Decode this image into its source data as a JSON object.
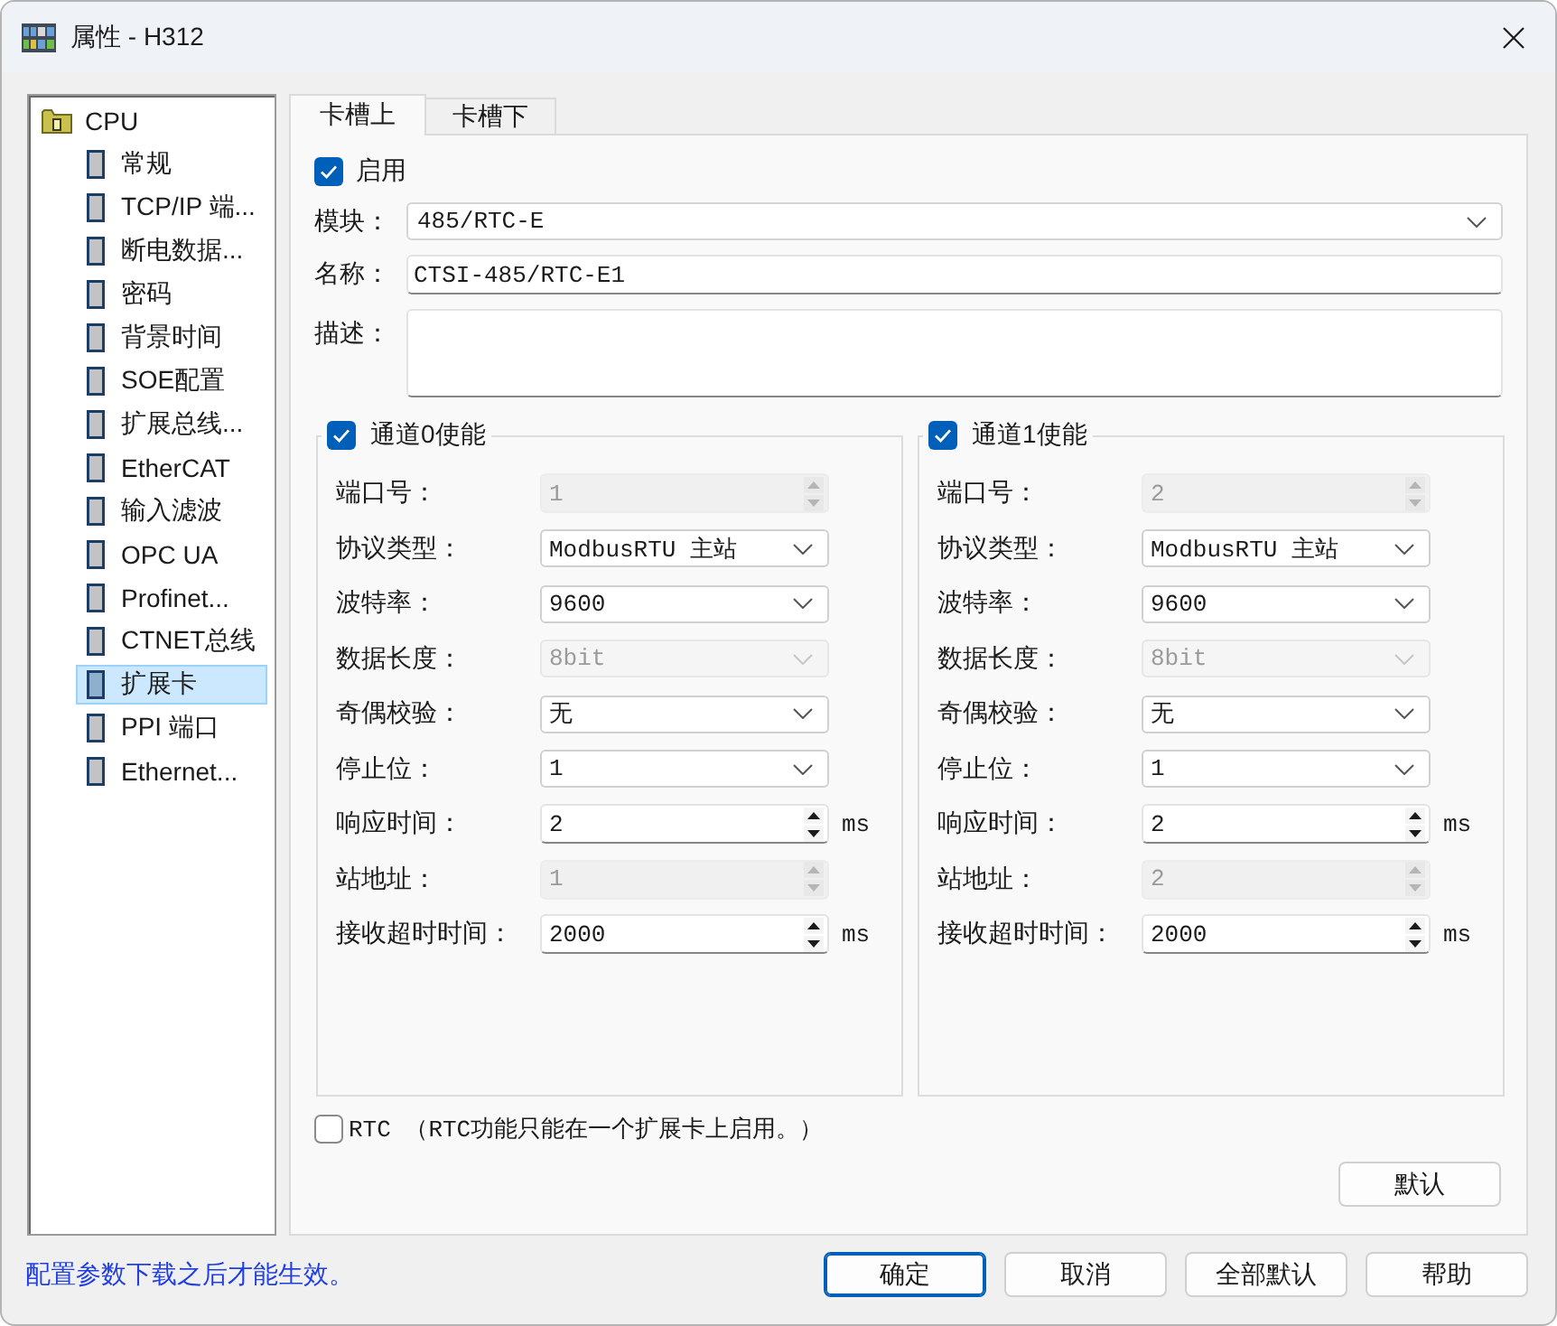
{
  "window": {
    "title": "属性 - H312"
  },
  "tree": [
    {
      "label": "CPU",
      "selected": false,
      "children": [
        {
          "label": "常规",
          "selected": false
        },
        {
          "label": "TCP/IP 端...",
          "selected": false
        },
        {
          "label": "断电数据...",
          "selected": false
        },
        {
          "label": "密码",
          "selected": false
        },
        {
          "label": "背景时间",
          "selected": false
        },
        {
          "label": "SOE配置",
          "selected": false
        },
        {
          "label": "扩展总线...",
          "selected": false
        },
        {
          "label": "EtherCAT",
          "selected": false
        },
        {
          "label": "输入滤波",
          "selected": false
        },
        {
          "label": "OPC UA",
          "selected": false
        },
        {
          "label": "Profinet...",
          "selected": false
        },
        {
          "label": "CTNET总线",
          "selected": false
        },
        {
          "label": "扩展卡",
          "selected": true
        },
        {
          "label": "PPI 端口",
          "selected": false
        },
        {
          "label": "Ethernet...",
          "selected": false
        }
      ]
    }
  ],
  "tabs": [
    {
      "label": "卡槽上",
      "selected": true
    },
    {
      "label": "卡槽下",
      "selected": false
    }
  ],
  "enable": {
    "label": "启用",
    "checked": true
  },
  "module": {
    "label": "模块：",
    "value": "485/RTC-E"
  },
  "name": {
    "label": "名称：",
    "value": "CTSI-485/RTC-E1"
  },
  "description": {
    "label": "描述："
  },
  "channels": [
    {
      "title": "通道0使能",
      "checked": true,
      "fields": [
        {
          "label": "端口号：",
          "kind": "spin",
          "value": "1",
          "disabled": true
        },
        {
          "label": "协议类型：",
          "kind": "select",
          "value": "ModbusRTU 主站",
          "disabled": false
        },
        {
          "label": "波特率：",
          "kind": "select",
          "value": "9600",
          "disabled": false
        },
        {
          "label": "数据长度：",
          "kind": "select",
          "value": "8bit",
          "disabled": true
        },
        {
          "label": "奇偶校验：",
          "kind": "select",
          "value": "无",
          "disabled": false
        },
        {
          "label": "停止位：",
          "kind": "select",
          "value": "1",
          "disabled": false
        },
        {
          "label": "响应时间：",
          "kind": "spin",
          "value": "2",
          "disabled": false,
          "unit": "ms"
        },
        {
          "label": "站地址：",
          "kind": "spin",
          "value": "1",
          "disabled": true
        },
        {
          "label": "接收超时时间：",
          "kind": "spin",
          "value": "2000",
          "disabled": false,
          "unit": "ms"
        }
      ]
    },
    {
      "title": "通道1使能",
      "checked": true,
      "fields": [
        {
          "label": "端口号：",
          "kind": "spin",
          "value": "2",
          "disabled": true
        },
        {
          "label": "协议类型：",
          "kind": "select",
          "value": "ModbusRTU 主站",
          "disabled": false
        },
        {
          "label": "波特率：",
          "kind": "select",
          "value": "9600",
          "disabled": false
        },
        {
          "label": "数据长度：",
          "kind": "select",
          "value": "8bit",
          "disabled": true
        },
        {
          "label": "奇偶校验：",
          "kind": "select",
          "value": "无",
          "disabled": false
        },
        {
          "label": "停止位：",
          "kind": "select",
          "value": "1",
          "disabled": false
        },
        {
          "label": "响应时间：",
          "kind": "spin",
          "value": "2",
          "disabled": false,
          "unit": "ms"
        },
        {
          "label": "站地址：",
          "kind": "spin",
          "value": "2",
          "disabled": true
        },
        {
          "label": "接收超时时间：",
          "kind": "spin",
          "value": "2000",
          "disabled": false,
          "unit": "ms"
        }
      ]
    }
  ],
  "rtc": {
    "label": "RTC （RTC功能只能在一个扩展卡上启用。）",
    "checked": false
  },
  "default_button": "默认",
  "status_text": "配置参数下载之后才能生效。",
  "footer_buttons": [
    {
      "label": "确定",
      "focused": true
    },
    {
      "label": "取消",
      "focused": false
    },
    {
      "label": "全部默认",
      "focused": false
    },
    {
      "label": "帮助",
      "focused": false
    }
  ]
}
